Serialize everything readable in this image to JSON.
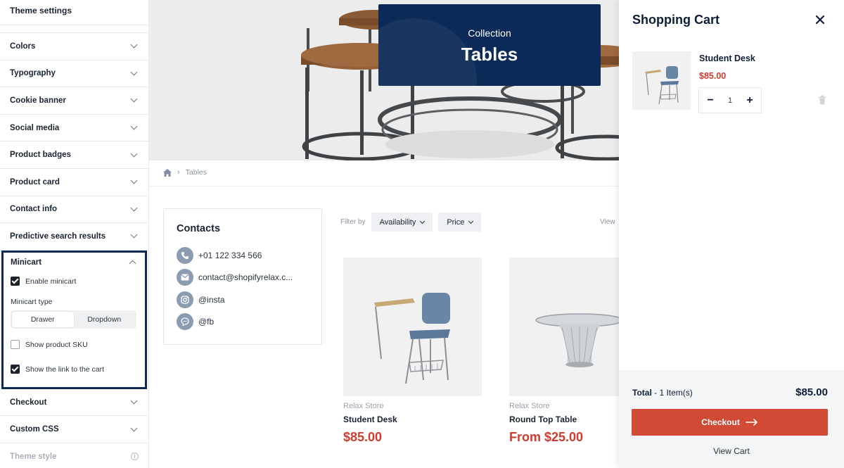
{
  "sidebar": {
    "title": "Theme settings",
    "sections": [
      {
        "label": "Colors"
      },
      {
        "label": "Typography"
      },
      {
        "label": "Cookie banner"
      },
      {
        "label": "Social media"
      },
      {
        "label": "Product badges"
      },
      {
        "label": "Product card"
      },
      {
        "label": "Contact info"
      },
      {
        "label": "Predictive search results"
      }
    ],
    "minicart": {
      "label": "Minicart",
      "enable_label": "Enable minicart",
      "enable_checked": true,
      "type_label": "Minicart type",
      "type_options": [
        "Drawer",
        "Dropdown"
      ],
      "type_selected": "Drawer",
      "sku_label": "Show product SKU",
      "sku_checked": false,
      "link_label": "Show the link to the cart",
      "link_checked": true
    },
    "after_sections": [
      {
        "label": "Checkout"
      },
      {
        "label": "Custom CSS"
      },
      {
        "label": "Theme style"
      }
    ]
  },
  "hero": {
    "subtitle": "Collection",
    "title": "Tables"
  },
  "breadcrumb": {
    "current": "Tables"
  },
  "contacts": {
    "title": "Contacts",
    "items": [
      {
        "icon": "phone-icon",
        "text": "+01 122 334 566"
      },
      {
        "icon": "mail-icon",
        "text": "contact@shopifyrelax.c..."
      },
      {
        "icon": "instagram-icon",
        "text": "@insta"
      },
      {
        "icon": "chat-icon",
        "text": "@fb"
      }
    ]
  },
  "filters": {
    "label": "Filter by",
    "buttons": [
      "Availability",
      "Price"
    ],
    "view_label": "View"
  },
  "products": [
    {
      "vendor": "Relax Store",
      "name": "Student Desk",
      "price": "$85.00"
    },
    {
      "vendor": "Relax Store",
      "name": "Round Top Table",
      "price": "From $25.00"
    }
  ],
  "cart": {
    "title": "Shopping Cart",
    "item": {
      "name": "Student Desk",
      "price": "$85.00",
      "quantity": "1"
    },
    "total_label": "Total",
    "total_items": " - 1 Item(s)",
    "total_value": "$85.00",
    "checkout_label": "Checkout",
    "view_cart_label": "View Cart"
  },
  "colors": {
    "navy": "#0c2a57",
    "price_red": "#cf3b2c",
    "checkout_red": "#d04a35"
  }
}
